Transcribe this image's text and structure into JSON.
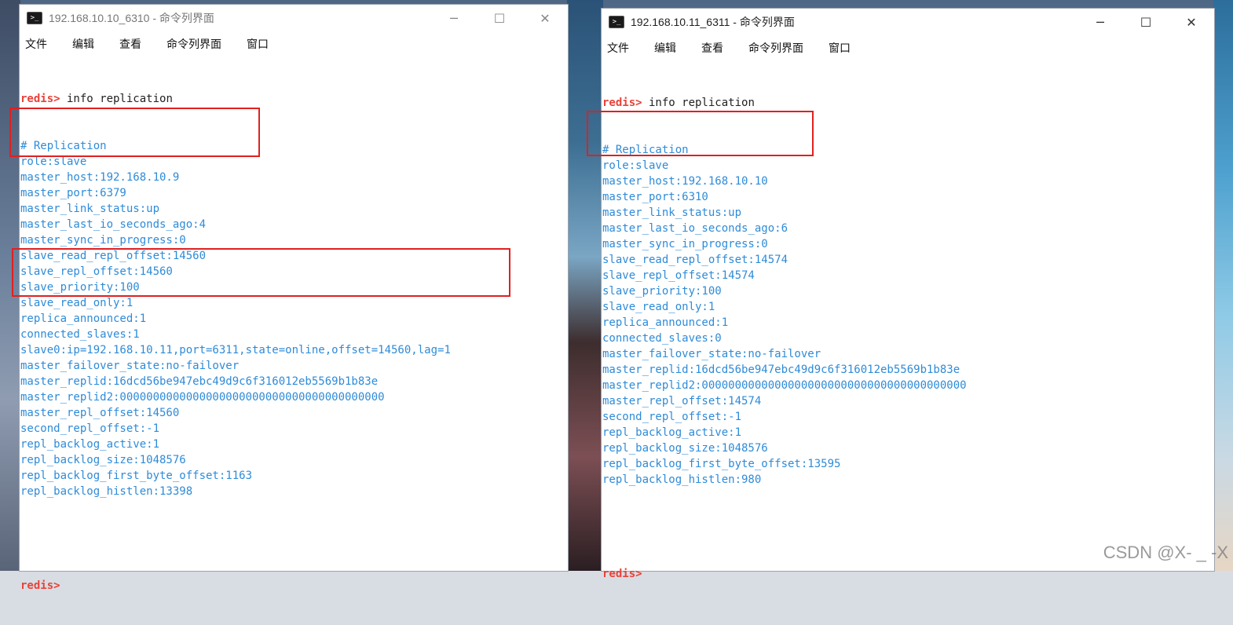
{
  "watermark": "CSDN @X- _ -X",
  "window1": {
    "title": "192.168.10.10_6310 - 命令列界面",
    "controls": {
      "minimize": "─",
      "maximize": "☐",
      "close": "✕"
    },
    "menu": [
      "文件",
      "编辑",
      "查看",
      "命令列界面",
      "窗口"
    ],
    "prompt": "redis>",
    "command": " info replication",
    "lines": [
      "# Replication",
      "role:slave",
      "master_host:192.168.10.9",
      "master_port:6379",
      "master_link_status:up",
      "master_last_io_seconds_ago:4",
      "master_sync_in_progress:0",
      "slave_read_repl_offset:14560",
      "slave_repl_offset:14560",
      "slave_priority:100",
      "slave_read_only:1",
      "replica_announced:1",
      "connected_slaves:1",
      "slave0:ip=192.168.10.11,port=6311,state=online,offset=14560,lag=1",
      "master_failover_state:no-failover",
      "master_replid:16dcd56be947ebc49d9c6f316012eb5569b1b83e",
      "master_replid2:0000000000000000000000000000000000000000",
      "master_repl_offset:14560",
      "second_repl_offset:-1",
      "repl_backlog_active:1",
      "repl_backlog_size:1048576",
      "repl_backlog_first_byte_offset:1163",
      "repl_backlog_histlen:13398"
    ],
    "final_prompt": "redis>"
  },
  "window2": {
    "title": "192.168.10.11_6311 - 命令列界面",
    "controls": {
      "minimize": "─",
      "maximize": "☐",
      "close": "✕"
    },
    "menu": [
      "文件",
      "编辑",
      "查看",
      "命令列界面",
      "窗口"
    ],
    "prompt": "redis>",
    "command": " info replication",
    "lines": [
      "# Replication",
      "role:slave",
      "master_host:192.168.10.10",
      "master_port:6310",
      "master_link_status:up",
      "master_last_io_seconds_ago:6",
      "master_sync_in_progress:0",
      "slave_read_repl_offset:14574",
      "slave_repl_offset:14574",
      "slave_priority:100",
      "slave_read_only:1",
      "replica_announced:1",
      "connected_slaves:0",
      "master_failover_state:no-failover",
      "master_replid:16dcd56be947ebc49d9c6f316012eb5569b1b83e",
      "master_replid2:0000000000000000000000000000000000000000",
      "master_repl_offset:14574",
      "second_repl_offset:-1",
      "repl_backlog_active:1",
      "repl_backlog_size:1048576",
      "repl_backlog_first_byte_offset:13595",
      "repl_backlog_histlen:980"
    ],
    "final_prompt": "redis>"
  },
  "colors": {
    "output_text": "#2e8bd8",
    "prompt": "#e8433a",
    "highlight_box": "#e02020"
  }
}
